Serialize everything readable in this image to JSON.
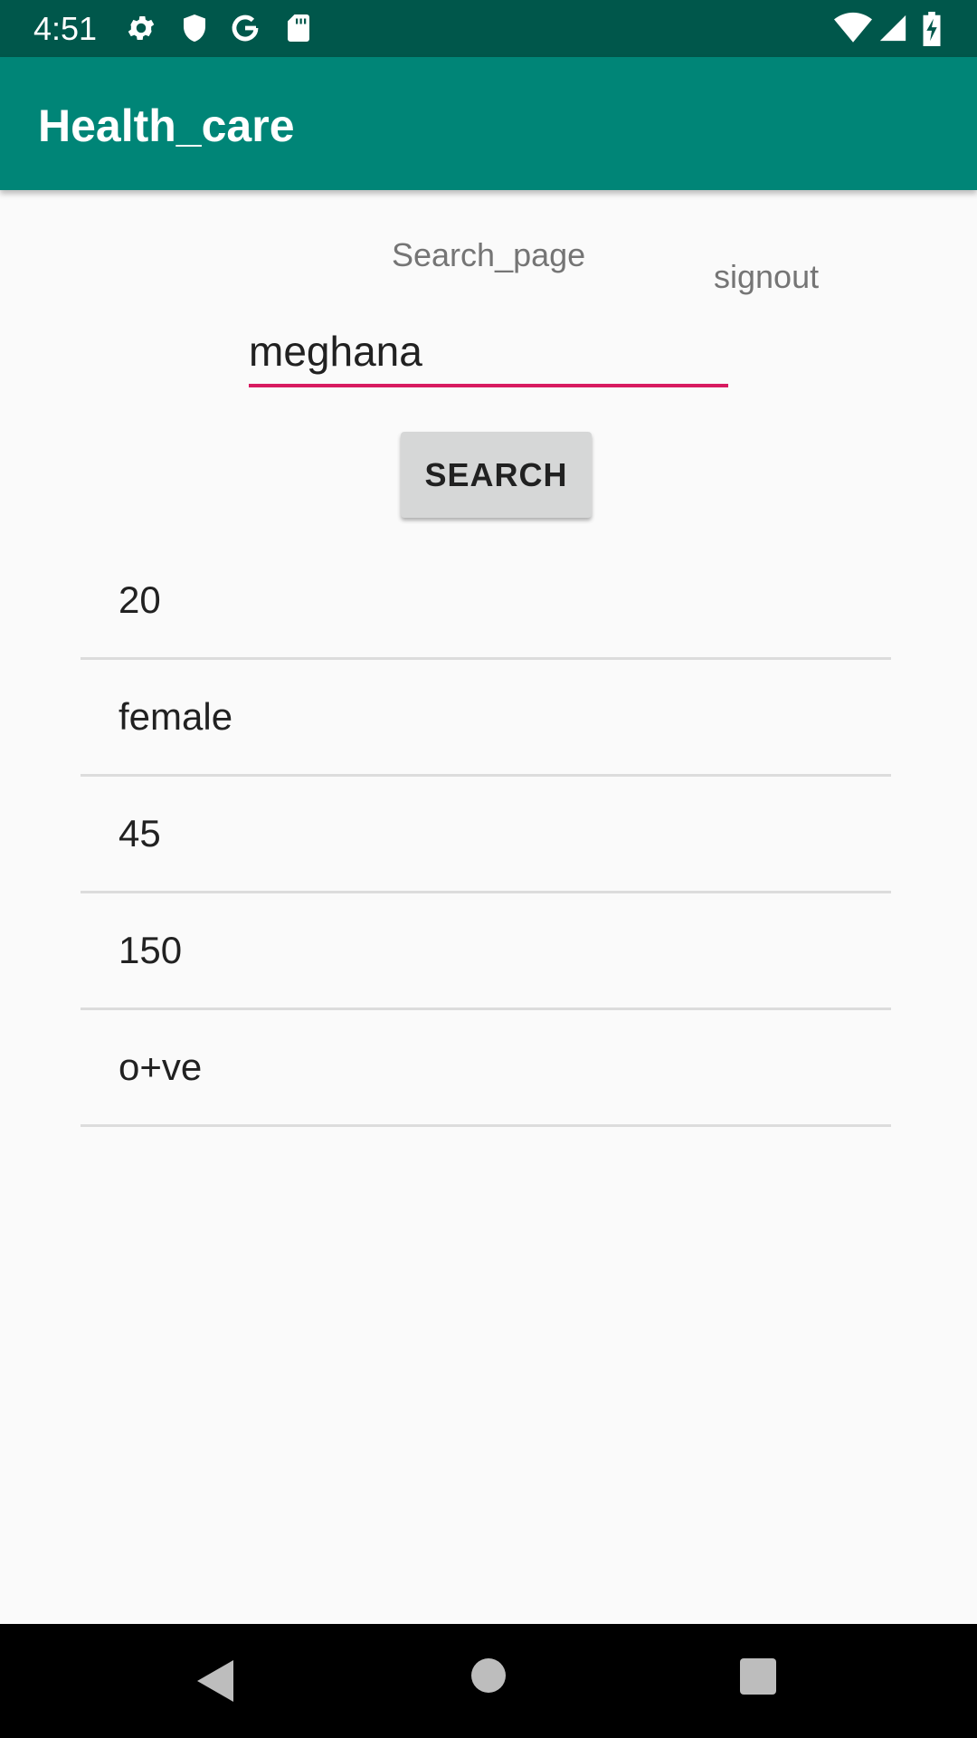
{
  "status_bar": {
    "time": "4:51",
    "icons": [
      "gear-icon",
      "shield-icon",
      "google-g-icon",
      "sd-card-icon",
      "wifi-icon",
      "cell-signal-icon",
      "battery-charging-icon"
    ]
  },
  "app_bar": {
    "title": "Health_care"
  },
  "main": {
    "page_label": "Search_page",
    "signout_label": "signout",
    "search_value": "meghana",
    "search_button_label": "SEARCH",
    "results": [
      "20",
      "female",
      "45",
      "150",
      "o+ve"
    ]
  },
  "colors": {
    "status_bar": "#00574b",
    "app_bar": "#008577",
    "accent": "#d81b60"
  },
  "nav_bar": {
    "icons": [
      "back-icon",
      "home-icon",
      "recent-apps-icon"
    ]
  }
}
